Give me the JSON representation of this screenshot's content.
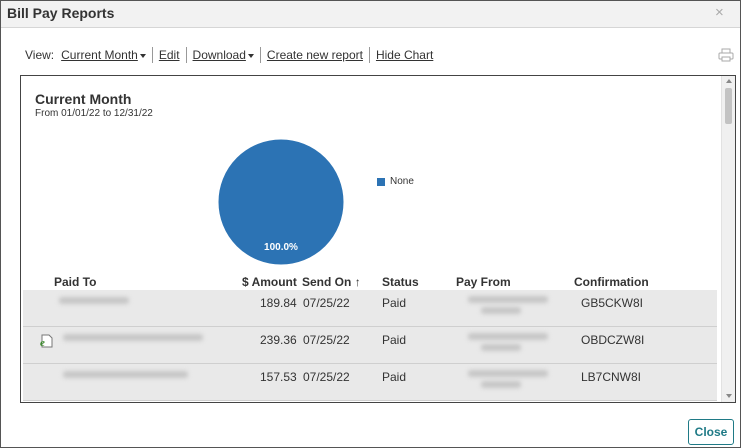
{
  "window": {
    "title": "Bill Pay Reports",
    "close_glyph": "×"
  },
  "toolbar": {
    "view_label": "View:",
    "view_value": "Current Month",
    "edit_label": "Edit",
    "download_label": "Download",
    "create_label": "Create new report",
    "hide_chart_label": "Hide Chart",
    "print_icon": "printer-icon"
  },
  "report": {
    "title": "Current Month",
    "subtitle": "From 01/01/22 to 12/31/22"
  },
  "chart_data": {
    "type": "pie",
    "slices": [
      {
        "name": "None",
        "value": 100.0,
        "label": "100.0%",
        "color": "#2c73b4"
      }
    ],
    "legend_position": "right"
  },
  "table": {
    "headers": {
      "paid_to": "Paid To",
      "amount": "$ Amount",
      "send_on": "Send On",
      "send_on_sort_glyph": "↑",
      "status": "Status",
      "pay_from": "Pay From",
      "confirmation": "Confirmation"
    },
    "rows": [
      {
        "amount": "189.84",
        "send_on": "07/25/22",
        "status": "Paid",
        "confirmation": "GB5CKW8I",
        "ebill": false
      },
      {
        "amount": "239.36",
        "send_on": "07/25/22",
        "status": "Paid",
        "confirmation": "OBDCZW8I",
        "ebill": true
      },
      {
        "amount": "157.53",
        "send_on": "07/25/22",
        "status": "Paid",
        "confirmation": "LB7CNW8I",
        "ebill": false
      }
    ]
  },
  "footer": {
    "close_label": "Close"
  },
  "colors": {
    "accent": "#1f7a86",
    "pie": "#2c73b4"
  }
}
